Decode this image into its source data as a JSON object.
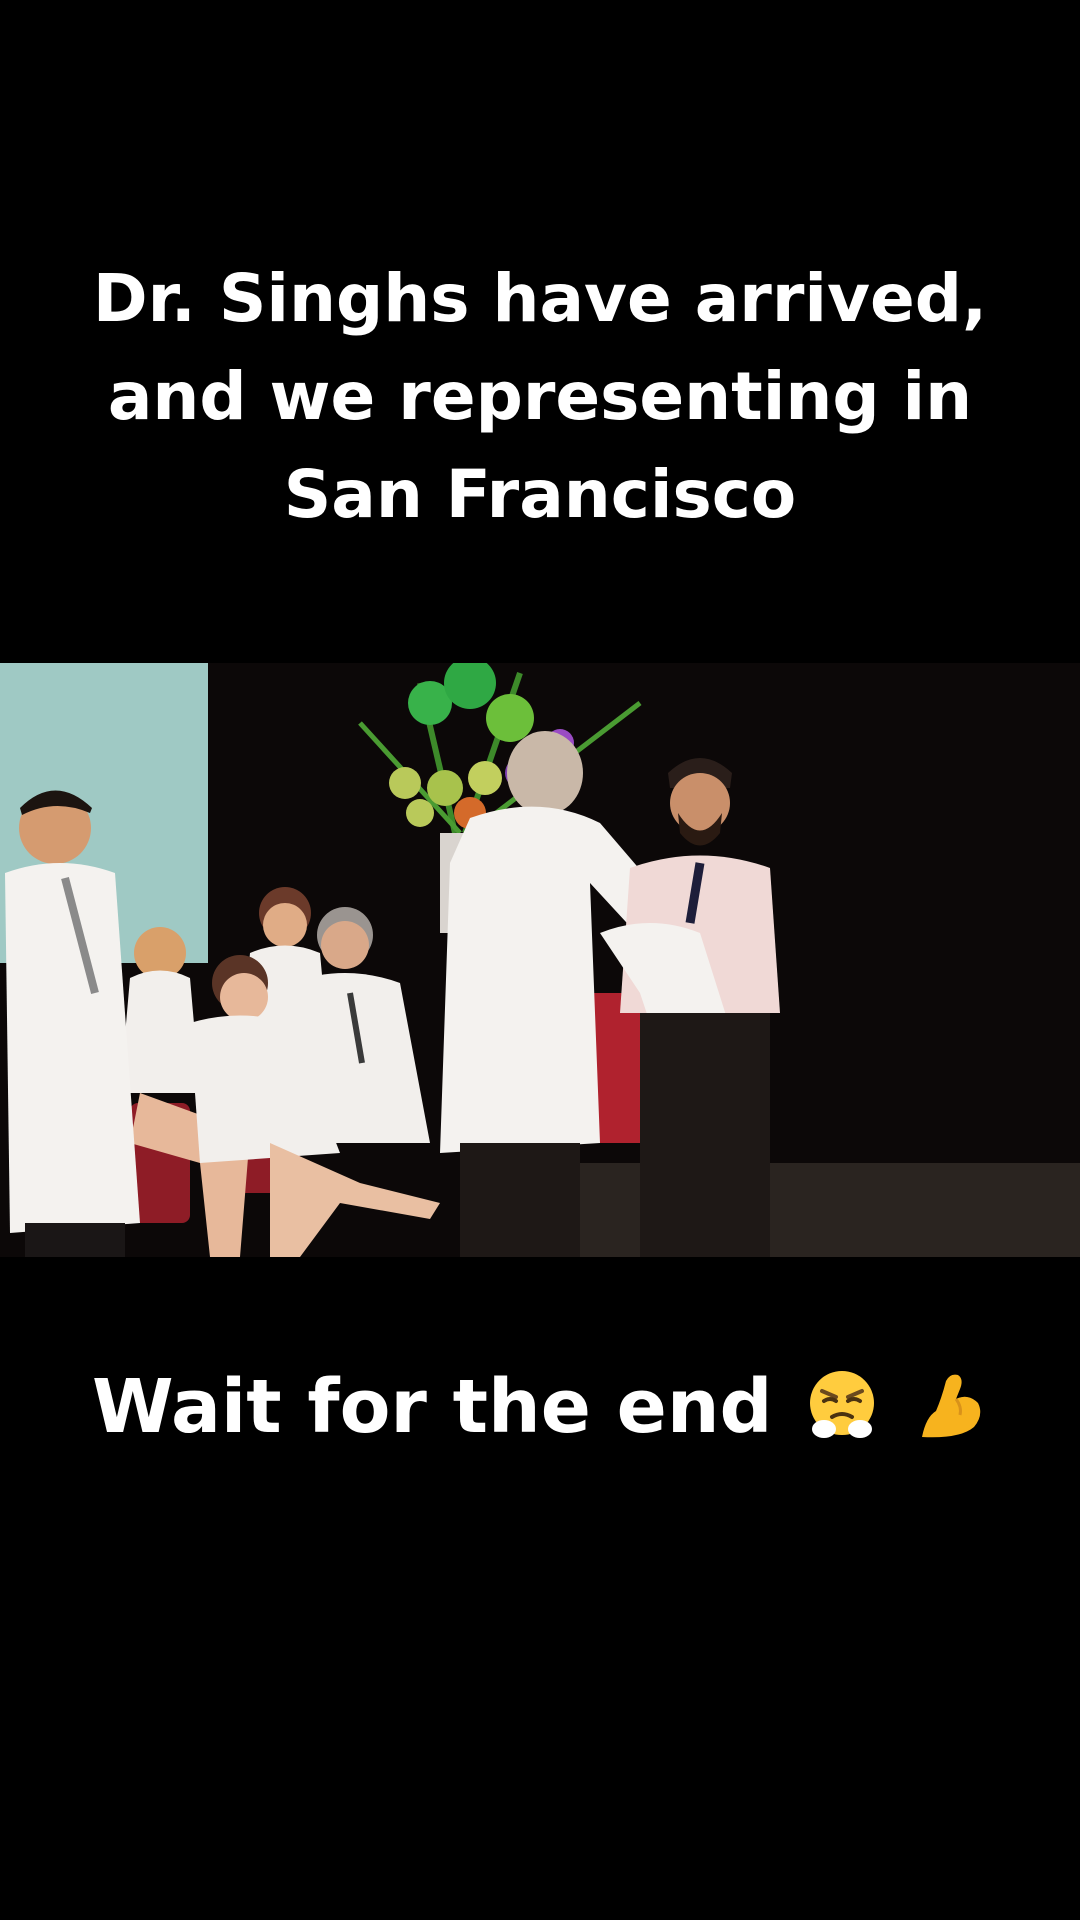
{
  "caption_top": {
    "lines": [
      "Dr. Singhs have arrived,",
      "and we representing in",
      "San Francisco"
    ]
  },
  "caption_bottom": {
    "text": "Wait for the end",
    "emojis": [
      "face-with-steam-from-nose-icon",
      "flexed-biceps-icon"
    ]
  },
  "video": {
    "scene": "white-coat-ceremony",
    "colors": {
      "backdrop": "#0c0808",
      "screen": "#9fc9c4",
      "coat": "#f2efec",
      "stage_floor": "#2a2420",
      "chair": "#b0222e"
    }
  }
}
